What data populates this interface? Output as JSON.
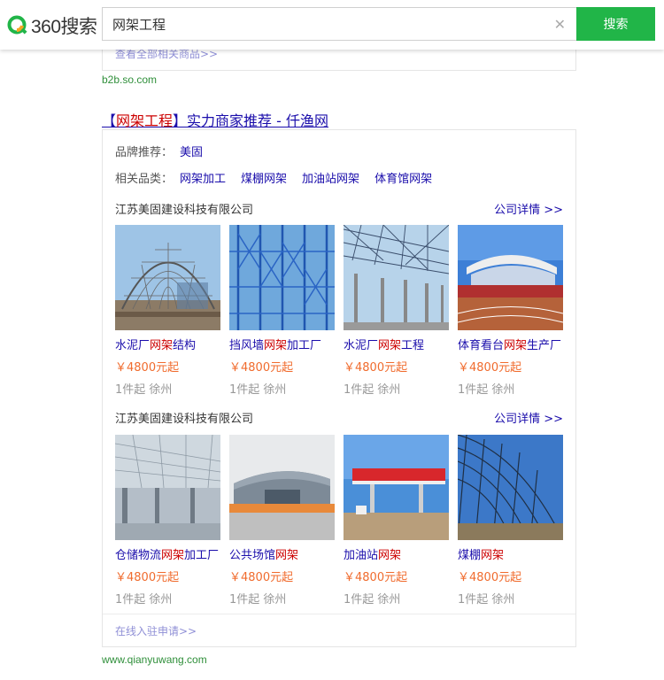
{
  "header": {
    "logo_text": "360搜索",
    "search_value": "网架工程",
    "search_button": "搜索"
  },
  "prev_result": {
    "more_link": "查看全部相关商品>>",
    "source": "b2b.so.com"
  },
  "result": {
    "title_prefix": "【",
    "title_highlight": "网架工程",
    "title_suffix": "】实力商家推荐 - 仟渔网",
    "brand_label": "品牌推荐：",
    "brand_value": "美固",
    "category_label": "相关品类：",
    "categories": [
      "网架加工",
      "煤棚网架",
      "加油站网架",
      "体育馆网架"
    ],
    "groups": [
      {
        "company": "江苏美固建设科技有限公司",
        "detail_link": "公司详情 >>",
        "products": [
          {
            "name_pre": "水泥厂",
            "name_hl": "网架",
            "name_post": "结构",
            "price": "￥4800元起",
            "meta": "1件起  徐州",
            "image": "dome-steel-structure"
          },
          {
            "name_pre": "挡风墙",
            "name_hl": "网架",
            "name_post": "加工厂",
            "price": "￥4800元起",
            "meta": "1件起  徐州",
            "image": "blue-frame-windwall"
          },
          {
            "name_pre": "水泥厂",
            "name_hl": "网架",
            "name_post": "工程",
            "price": "￥4800元起",
            "meta": "1件起  徐州",
            "image": "space-frame-columns"
          },
          {
            "name_pre": "体育看台",
            "name_hl": "网架",
            "name_post": "生产厂",
            "price": "￥4800元起",
            "meta": "1件起  徐州",
            "image": "stadium-stand"
          }
        ]
      },
      {
        "company": "江苏美固建设科技有限公司",
        "detail_link": "公司详情 >>",
        "products": [
          {
            "name_pre": "仓储物流",
            "name_hl": "网架",
            "name_post": "加工厂",
            "price": "￥4800元起",
            "meta": "1件起  徐州",
            "image": "warehouse-interior"
          },
          {
            "name_pre": "公共场馆",
            "name_hl": "网架",
            "name_post": "",
            "price": "￥4800元起",
            "meta": "1件起  徐州",
            "image": "public-venue"
          },
          {
            "name_pre": "加油站",
            "name_hl": "网架",
            "name_post": "",
            "price": "￥4800元起",
            "meta": "1件起  徐州",
            "image": "gas-station-canopy"
          },
          {
            "name_pre": "煤棚",
            "name_hl": "网架",
            "name_post": "",
            "price": "￥4800元起",
            "meta": "1件起  徐州",
            "image": "coal-shed-frame"
          }
        ]
      }
    ],
    "apply_link": "在线入驻申请>>",
    "source": "www.qianyuwang.com"
  },
  "colors": {
    "brand_green": "#21b548",
    "link_blue": "#1a0dab",
    "highlight_red": "#cc0000",
    "price_orange": "#f06b2d",
    "source_green": "#2f8f3a"
  }
}
